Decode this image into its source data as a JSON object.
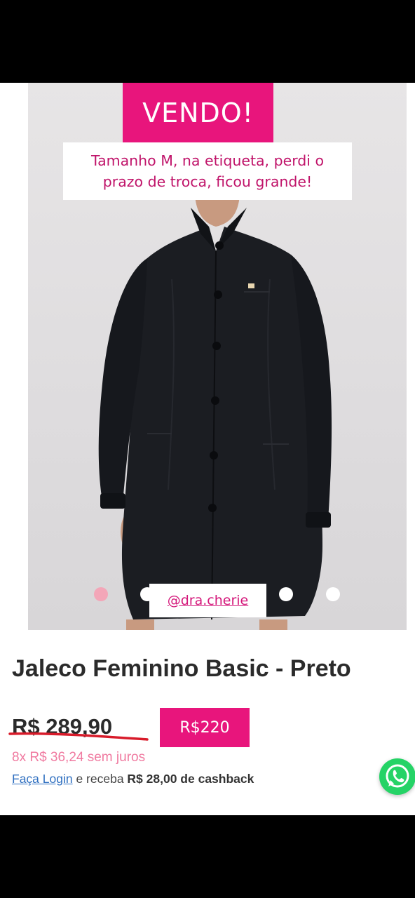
{
  "story_overlay": {
    "banner_text": "VENDO!",
    "note_line_1": "Tamanho M, na etiqueta, perdi o",
    "note_line_2": "prazo de troca, ficou grande!",
    "handle": "@dra.cherie"
  },
  "carousel": {
    "total_dots": 4,
    "active_index": 0
  },
  "product": {
    "title": "Jaleco Feminino Basic - Preto",
    "old_price": "R$ 289,90",
    "new_price": "R$220",
    "installments": "8x R$ 36,24 sem juros",
    "login_link": "Faça Login",
    "cashback_text": " e receba ",
    "cashback_amount": "R$ 28,00 de cashback"
  },
  "colors": {
    "accent_pink": "#e8157c",
    "installment_pink": "#f07aa0",
    "link_blue": "#2f6fc0",
    "whatsapp_green": "#25d366"
  },
  "icons": {
    "chat": "whatsapp-icon"
  }
}
